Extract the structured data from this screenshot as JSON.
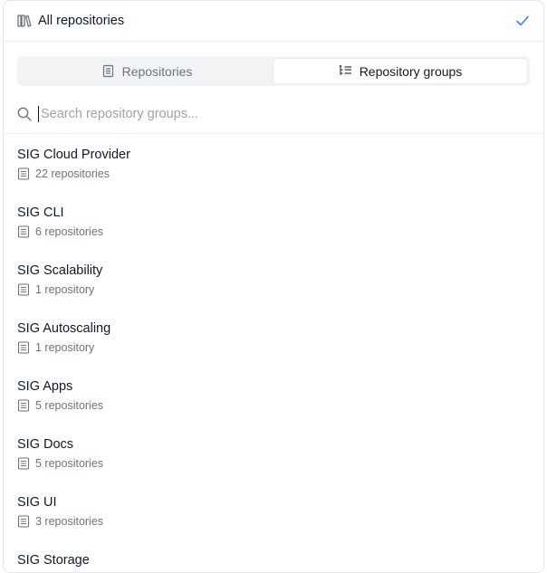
{
  "header": {
    "title": "All repositories",
    "books_icon": "books-icon",
    "check_icon": "check-icon"
  },
  "tabs": [
    {
      "label": "Repositories",
      "icon": "repository-icon",
      "active": false
    },
    {
      "label": "Repository groups",
      "icon": "list-tree-icon",
      "active": true
    }
  ],
  "search": {
    "placeholder": "Search repository groups...",
    "value": ""
  },
  "groups": [
    {
      "name": "SIG Cloud Provider",
      "count": "22 repositories"
    },
    {
      "name": "SIG CLI",
      "count": "6 repositories"
    },
    {
      "name": "SIG Scalability",
      "count": "1 repository"
    },
    {
      "name": "SIG Autoscaling",
      "count": "1 repository"
    },
    {
      "name": "SIG Apps",
      "count": "5 repositories"
    },
    {
      "name": "SIG Docs",
      "count": "5 repositories"
    },
    {
      "name": "SIG UI",
      "count": "3 repositories"
    },
    {
      "name": "SIG Storage",
      "count": ""
    }
  ],
  "colors": {
    "accent": "#3b82f6",
    "muted_text": "#6b7280",
    "tab_bg": "#f2f3f5"
  }
}
